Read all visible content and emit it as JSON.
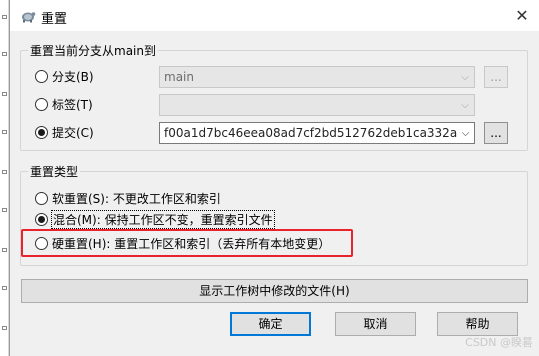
{
  "window": {
    "title": "重置",
    "close_glyph": "✕"
  },
  "branch_group": {
    "legend": "重置当前分支从main到",
    "options": [
      {
        "label": "分支(B)",
        "checked": false,
        "combo_value": "main",
        "combo_enabled": false
      },
      {
        "label": "标签(T)",
        "checked": false,
        "combo_value": "",
        "combo_enabled": false
      },
      {
        "label": "提交(C)",
        "checked": true,
        "combo_value": "f00a1d7bc46eea08ad7cf2bd512762deb1ca332a",
        "combo_enabled": true
      }
    ],
    "browse_label": "..."
  },
  "reset_type_group": {
    "legend": "重置类型",
    "options": [
      {
        "label": "软重置(S): 不更改工作区和索引",
        "checked": false
      },
      {
        "label": "混合(M): 保持工作区不变，重置索引文件",
        "checked": true
      },
      {
        "label": "硬重置(H): 重置工作区和索引（丢弃所有本地变更）",
        "checked": false
      }
    ]
  },
  "buttons": {
    "show_changes": "显示工作树中修改的文件(H)",
    "ok": "确定",
    "cancel": "取消",
    "help": "帮助"
  },
  "watermark": "CSDN @睽晷",
  "colors": {
    "highlight_border": "#e8232e",
    "default_button_border": "#0078d7"
  }
}
